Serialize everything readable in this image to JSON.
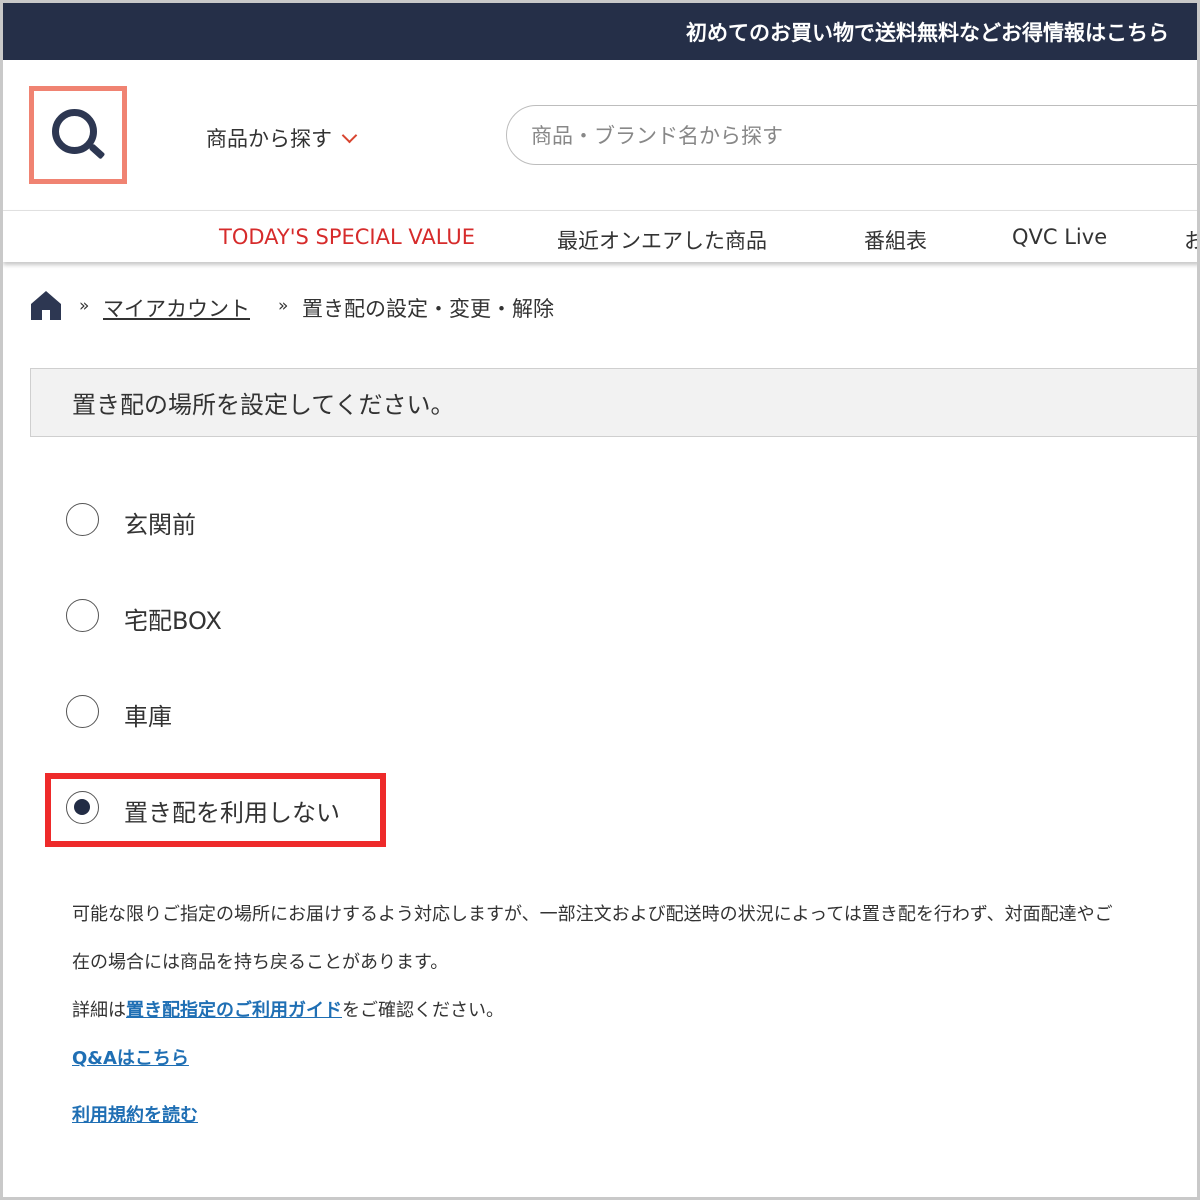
{
  "banner": {
    "text": "初めてのお買い物で送料無料などお得情報はこちら"
  },
  "header": {
    "logo_letter": "Q",
    "browse_label": "商品から探す",
    "search_placeholder": "商品・ブランド名から探す"
  },
  "nav": {
    "items": [
      {
        "label": "TODAY'S SPECIAL VALUE"
      },
      {
        "label": "最近オンエアした商品"
      },
      {
        "label": "番組表"
      },
      {
        "label": "QVC Live"
      },
      {
        "label": "お"
      }
    ]
  },
  "breadcrumb": {
    "separator": "»",
    "link": "マイアカウント",
    "current": "置き配の設定・変更・解除"
  },
  "instruction": "置き配の場所を設定してください。",
  "options": [
    {
      "label": "玄関前",
      "selected": false
    },
    {
      "label": "宅配BOX",
      "selected": false
    },
    {
      "label": "車庫",
      "selected": false
    },
    {
      "label": "置き配を利用しない",
      "selected": true
    }
  ],
  "notes": {
    "line1": "可能な限りご指定の場所にお届けするよう対応しますが、一部注文および配送時の状況によっては置き配を行わず、対面配達やご",
    "line2": "在の場合には商品を持ち戻ることがあります。",
    "line3_prefix": "詳細は",
    "line3_link": "置き配指定のご利用ガイド",
    "line3_suffix": "をご確認ください。",
    "qa_link": "Q&Aはこちら",
    "terms_link": "利用規約を読む"
  },
  "colors": {
    "banner_bg": "#252f48",
    "logo_border": "#f08372",
    "nav_highlight": "#d62b2b",
    "link": "#1f6fb4",
    "callout": "#ee2a2a"
  }
}
